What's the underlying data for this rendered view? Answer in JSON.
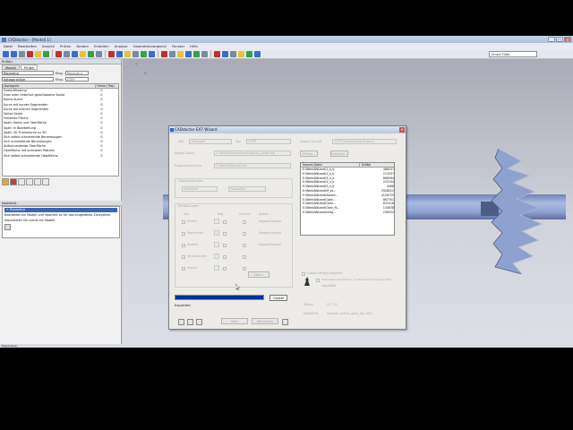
{
  "window": {
    "title": "CADdoctor - [Modell 1]",
    "controls": [
      "_",
      "□",
      "✕"
    ]
  },
  "menu": [
    "Datei",
    "Bearbeiten",
    "Ansicht",
    "Prüfen",
    "Ändern",
    "Erstellen",
    "Analyse",
    "Geometrievergleich",
    "Fenster",
    "Hilfe"
  ],
  "toolbar": {
    "search_value": "Smart Filter",
    "button_colors": [
      "#3a6ec6",
      "#3a6ec6",
      "#7a8aa0",
      "#c03030",
      "#e8c23a",
      "#3aa04a",
      "#c03030",
      "#7a8aa0",
      "#3a6ec6",
      "#e8c23a",
      "#3aa04a",
      "#7a8aa0",
      "#c03030",
      "#3a6ec6",
      "#e8c23a",
      "#7a8aa0",
      "#3aa04a",
      "#3a6ec6",
      "#c03030",
      "#7a8aa0",
      "#e8c23a",
      "#3a6ec6",
      "#3aa04a",
      "#7a8aa0",
      "#c03030",
      "#3a6ec6",
      "#7a8aa0",
      "#e8c23a",
      "#3aa04a",
      "#3a6ec6"
    ]
  },
  "left_panel": {
    "header": "Prüfen",
    "tabs": [
      "Modell",
      "Prüfen"
    ],
    "name_value": "Reparatur",
    "name_label": "Eing.",
    "name_select": "Reparatur",
    "category_value": "Kategorieliste",
    "category_label": "Eing.",
    "category_select": "STEP",
    "columns": [
      "Kategorie",
      "Fehler",
      "Rep."
    ],
    "rows": [
      {
        "name": "Draht/Windung",
        "err": "0"
      },
      {
        "name": "Dran oder Unterfort geschlossene Kante",
        "err": "0"
      },
      {
        "name": "Kleine Kurve",
        "err": "0"
      },
      {
        "name": "Kurve mit kurzen Segmenten",
        "err": "0"
      },
      {
        "name": "Kurve mit kleinen Segmenten",
        "err": "0"
      },
      {
        "name": "Spitze Kante",
        "err": "0"
      },
      {
        "name": "Fehlende Fläche",
        "err": "0"
      },
      {
        "name": "Spalt: Kante und Oberfläche",
        "err": "0"
      },
      {
        "name": "Spalt: In Bearbeitung",
        "err": "0"
      },
      {
        "name": "Spalt: 2D Trimmkurve zu 3D",
        "err": "0"
      },
      {
        "name": "Sich selbst schneidende Berandungen",
        "err": "0"
      },
      {
        "name": "Sich schneidende Berandungen",
        "err": "0"
      },
      {
        "name": "Aufschneidende Oberfläche",
        "err": "0"
      },
      {
        "name": "Oberfläche mit schmalen Patches",
        "err": "0"
      },
      {
        "name": "Sich selbst schneidende Oberfläche",
        "err": "0"
      }
    ]
  },
  "assistant": {
    "header": "Assistent",
    "title": "+ Reparatur",
    "text1": "Bearbeitet ein Modell und repariert es für das eingestellte Zielsystem.",
    "text2": "Importieren Sie zuerst ein Modell"
  },
  "viewport": {
    "axis_y": "Y",
    "axis_x": "X"
  },
  "dialog": {
    "title": "CADdoctor EX7 Wizard",
    "source_label": "Ziel",
    "source_value": "Parasolid",
    "format_label": "Typ",
    "format_value": "STEP",
    "target_label": "Export-Format",
    "target_value": "STEP (Dateiformat/Export)",
    "import_file_label": "Import-Datei",
    "import_file_value": "E:\\WerkAWizard\\test\\catalog_sheet.stp",
    "browse_label": "Öffnen...",
    "more_label": "Erstellen...",
    "export_folder_label": "Exportverzeichnis",
    "export_folder_value": "E:\\WerkAWizard\\test",
    "options_label": "Optionsvorlagen",
    "options_value": "Standard",
    "options_select": "Reparatur",
    "settings_label": "Einstellungen",
    "col_headers": [
      "Ziel",
      "Rep.",
      "Suchen",
      "Status"
    ],
    "row_labels": [
      "Prüfen",
      "Reparieren",
      "Ändern",
      "Vereinfachen",
      "Export"
    ],
    "row_status": [
      "Abgeschlossen",
      "Abgeschlossen",
      "Abgeschlossen"
    ],
    "apply_label": "Übern.",
    "cancel_label": "Cancel",
    "file_columns": [
      "Import-Datei",
      "Größe"
    ],
    "files": [
      {
        "name": "E:\\WerkAWizard\\1_o_b",
        "size": "486047"
      },
      {
        "name": "E:\\WerkAWizard\\2_o_b",
        "size": "213297"
      },
      {
        "name": "E:\\WerkAWizard\\3_n_b",
        "size": "666584"
      },
      {
        "name": "E:\\WerkAWizard\\4_n_b",
        "size": "225344"
      },
      {
        "name": "E:\\WerkAWizard\\5_n_b",
        "size": "4088"
      },
      {
        "name": "E:\\WerkAWizard\\M_va...",
        "size": "2928022"
      },
      {
        "name": "E:\\WerkAWizard\\Assem...",
        "size": "4126725"
      },
      {
        "name": "E:\\WerkAWizard\\Gear...",
        "size": "667301"
      },
      {
        "name": "E:\\WerkAWizard\\Gear...",
        "size": "633416"
      },
      {
        "name": "E:\\WerkAWizard\\Gear_fli...",
        "size": "134638"
      },
      {
        "name": "E:\\WerkAWizard\\integ...",
        "size": "236552"
      }
    ],
    "check1_label": "Export-Verlauf kopieren",
    "check2_label": "Fehlerliste exportieren / in Zielverzeichnis speichern",
    "log_label": "Log-Datei",
    "status_label": "Status",
    "status_value": "22 / 11",
    "current_label": "Datei/Info",
    "current_value": "integral_metric_gear_dis_3D3",
    "progress_pct": 100,
    "exporting_label": "Exportiert",
    "start_label": "Start",
    "cancel2_label": "Abbrechen"
  },
  "statusbar": "Exportieren"
}
